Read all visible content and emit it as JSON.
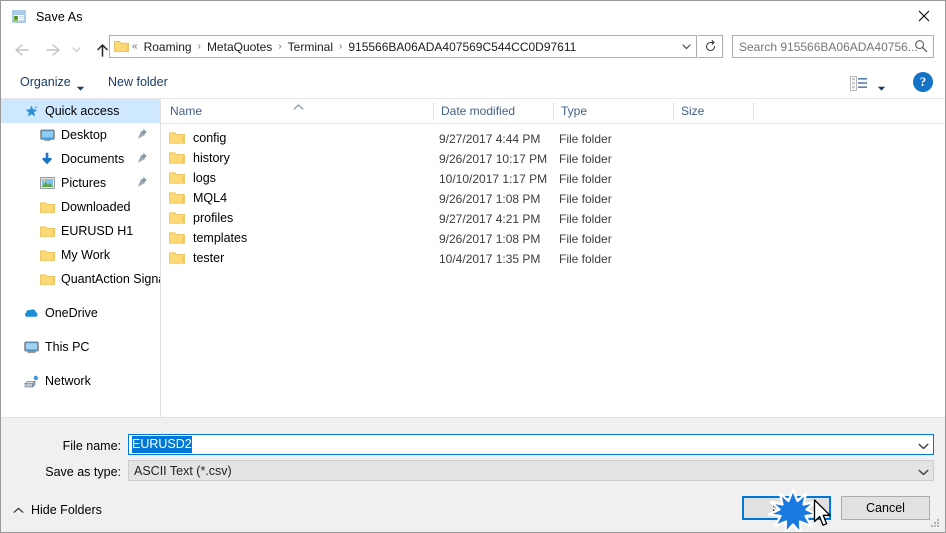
{
  "window": {
    "title": "Save As",
    "icon": "save-as-app-icon",
    "close_label": "✕"
  },
  "nav": {
    "back_icon": "arrow-left-icon",
    "forward_icon": "arrow-right-icon",
    "recent_icon": "chevron-down-icon",
    "up_icon": "arrow-up-icon",
    "refresh_icon": "refresh-icon",
    "address_dropdown_icon": "chevron-down-icon"
  },
  "breadcrumb": {
    "prefix": "«",
    "items": [
      "Roaming",
      "MetaQuotes",
      "Terminal",
      "915566BA06ADA407569C544CC0D97611"
    ],
    "separator": "›"
  },
  "search": {
    "placeholder": "Search 915566BA06ADA40756...",
    "icon": "search-icon"
  },
  "toolbar": {
    "organize_label": "Organize",
    "organize_arrow": "chevron-down-icon",
    "new_folder_label": "New folder",
    "view_icon": "view-layout-icon",
    "view_arrow": "chevron-down-icon",
    "help_label": "?"
  },
  "sidebar": {
    "items": [
      {
        "label": "Quick access",
        "icon": "star-pin-icon",
        "level": 0,
        "selected": true,
        "pinned": false
      },
      {
        "label": "Desktop",
        "icon": "desktop-icon",
        "level": 1,
        "selected": false,
        "pinned": true
      },
      {
        "label": "Documents",
        "icon": "documents-arrow-icon",
        "level": 1,
        "selected": false,
        "pinned": true
      },
      {
        "label": "Pictures",
        "icon": "pictures-icon",
        "level": 1,
        "selected": false,
        "pinned": true
      },
      {
        "label": "Downloaded",
        "icon": "folder-icon",
        "level": 1,
        "selected": false,
        "pinned": false
      },
      {
        "label": "EURUSD H1",
        "icon": "folder-icon",
        "level": 1,
        "selected": false,
        "pinned": false
      },
      {
        "label": "My Work",
        "icon": "folder-icon",
        "level": 1,
        "selected": false,
        "pinned": false
      },
      {
        "label": "QuantAction Signal",
        "icon": "folder-icon",
        "level": 1,
        "selected": false,
        "pinned": false
      },
      {
        "label": "OneDrive",
        "icon": "onedrive-cloud-icon",
        "level": 0,
        "selected": false,
        "pinned": false
      },
      {
        "label": "This PC",
        "icon": "this-pc-icon",
        "level": 0,
        "selected": false,
        "pinned": false
      },
      {
        "label": "Network",
        "icon": "network-icon",
        "level": 0,
        "selected": false,
        "pinned": false
      }
    ]
  },
  "filelist": {
    "columns": [
      "Name",
      "Date modified",
      "Type",
      "Size"
    ],
    "sort_column": "Name",
    "sort_direction": "ascending",
    "rows": [
      {
        "name": "config",
        "date": "9/27/2017 4:44 PM",
        "type": "File folder",
        "size": ""
      },
      {
        "name": "history",
        "date": "9/26/2017 10:17 PM",
        "type": "File folder",
        "size": ""
      },
      {
        "name": "logs",
        "date": "10/10/2017 1:17 PM",
        "type": "File folder",
        "size": ""
      },
      {
        "name": "MQL4",
        "date": "9/26/2017 1:08 PM",
        "type": "File folder",
        "size": ""
      },
      {
        "name": "profiles",
        "date": "9/27/2017 4:21 PM",
        "type": "File folder",
        "size": ""
      },
      {
        "name": "templates",
        "date": "9/26/2017 1:08 PM",
        "type": "File folder",
        "size": ""
      },
      {
        "name": "tester",
        "date": "10/4/2017 1:35 PM",
        "type": "File folder",
        "size": ""
      }
    ]
  },
  "form": {
    "filename_label": "File name:",
    "filename_value": "EURUSD2",
    "filename_selected": true,
    "filetype_label": "Save as type:",
    "filetype_value": "ASCII Text (*.csv)",
    "dropdown_icon": "chevron-down-icon"
  },
  "footer": {
    "hide_folders_label": "Hide Folders",
    "hide_folders_icon": "chevron-up-icon",
    "save_label": "Save",
    "cancel_label": "Cancel",
    "resize_grip_icon": "resize-grip-icon"
  },
  "overlay": {
    "click_burst_icon": "click-burst-icon",
    "cursor_icon": "mouse-pointer-icon"
  },
  "colors": {
    "accent": "#0078d7",
    "selection": "#cde8ff",
    "header_text": "#42618a",
    "toolbar_text": "#1a3c66",
    "folder_yellow": "#fdd96a",
    "chrome_gray": "#f0f0f0"
  }
}
